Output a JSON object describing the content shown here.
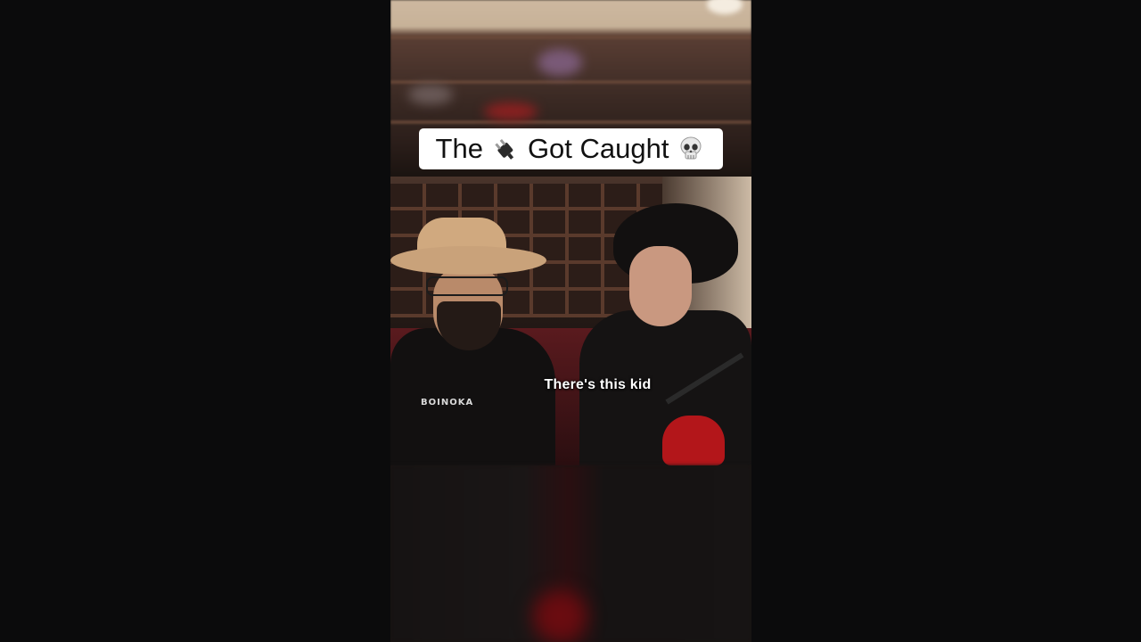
{
  "title_banner": {
    "before_icon": "The",
    "after_icon": "Got Caught",
    "icons": [
      "electric-plug-icon",
      "skull-icon"
    ]
  },
  "caption": "There's this kid",
  "shirt_print": "BOINOKA",
  "colors": {
    "page_background": "#0b0b0c",
    "banner_background": "#ffffff",
    "banner_text": "#111111",
    "caption_text": "#ffffff"
  }
}
